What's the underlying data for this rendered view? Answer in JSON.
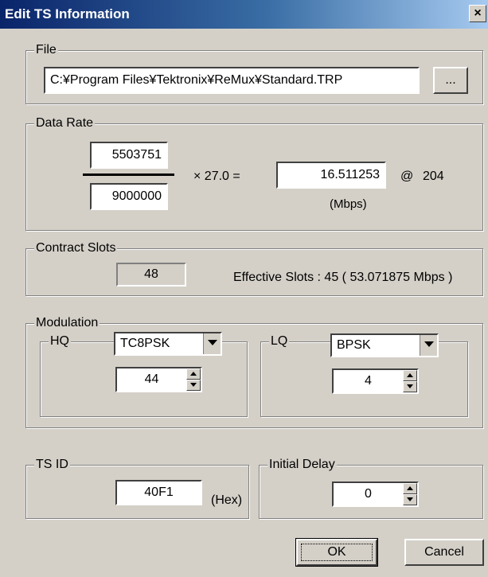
{
  "window": {
    "title": "Edit TS Information",
    "close_label": "×"
  },
  "file": {
    "group_label": "File",
    "path": "C:¥Program Files¥Tektronix¥ReMux¥Standard.TRP",
    "browse_label": "..."
  },
  "data_rate": {
    "group_label": "Data Rate",
    "numerator": "5503751",
    "denominator": "9000000",
    "multiplier_text": "× 27.0 =",
    "result": "16.511253",
    "at_label": "@",
    "packet_size": "204",
    "unit_label": "(Mbps)"
  },
  "contract_slots": {
    "group_label": "Contract Slots",
    "value": "48",
    "effective_text": "Effective Slots : 45  ( 53.071875 Mbps )"
  },
  "modulation": {
    "group_label": "Modulation",
    "hq": {
      "group_label": "HQ",
      "scheme": "TC8PSK",
      "value": "44"
    },
    "lq": {
      "group_label": "LQ",
      "scheme": "BPSK",
      "value": "4"
    }
  },
  "ts_id": {
    "group_label": "TS ID",
    "value": "40F1",
    "unit_label": "(Hex)"
  },
  "initial_delay": {
    "group_label": "Initial Delay",
    "value": "0"
  },
  "buttons": {
    "ok_label": "OK",
    "cancel_label": "Cancel"
  }
}
